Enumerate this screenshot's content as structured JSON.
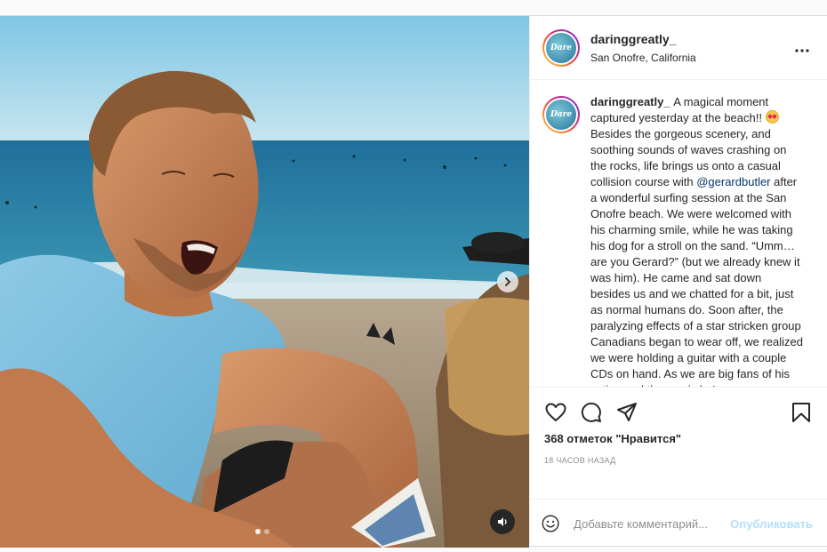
{
  "post": {
    "username": "daringgreatly_",
    "location": "San Onofre, California",
    "avatar_text": "Dare",
    "caption_user": "daringgreatly_",
    "caption_part1": "A magical moment captured yesterday at the beach!! ",
    "caption_emoji": "star-struck-emoji",
    "caption_part2": " Besides the gorgeous scenery, and soothing sounds of waves crashing on the rocks, life brings us onto a casual collision course with ",
    "caption_mention": "@gerardbutler",
    "caption_part3": " after a wonderful surfing session at the San Onofre beach. We were welcomed with his charming smile, while he was taking his dog for a stroll on the sand. “Umm… are you Gerard?” (but we already knew it was him). He came and sat down besides us and we chatted for a bit, just as normal humans do. Soon after, the paralyzing effects of a star stricken group Canadians began to wear off, we realized we were holding a guitar with a couple CDs on hand. As we are big fans of his acting and the music he’",
    "likes": "368 отметок \"Нравится\"",
    "timestamp": "18 часов назад",
    "comment_placeholder": "Добавьте комментарий...",
    "publish_label": "Опубликовать"
  },
  "media": {
    "carousel_count": 2,
    "carousel_active": 1,
    "next_icon": "chevron-right-icon",
    "sound_icon": "speaker-icon"
  },
  "icons": {
    "more": "more-horizontal-icon",
    "like": "heart-icon",
    "comment": "comment-bubble-icon",
    "share": "paper-plane-icon",
    "save": "bookmark-icon",
    "emoji": "smiley-icon"
  },
  "colors": {
    "mention": "#00376b",
    "publish_disabled": "#b2dffc",
    "secondary_text": "#8e8e8e",
    "border": "#dbdbdb"
  }
}
